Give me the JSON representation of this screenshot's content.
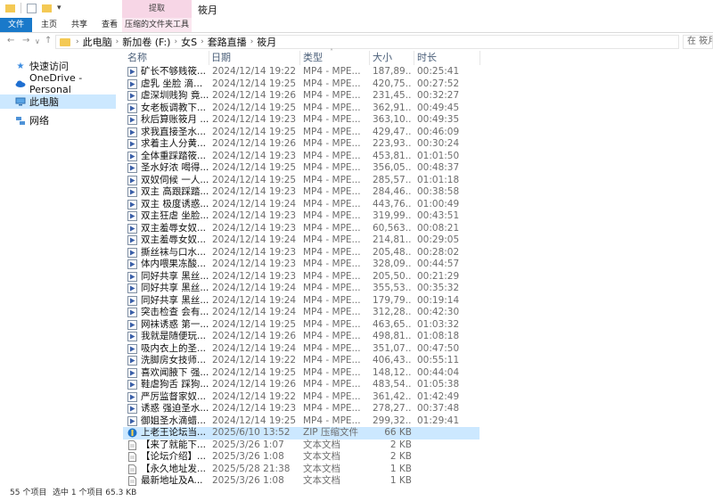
{
  "window": {
    "title": "筱月",
    "context_group": "提取"
  },
  "ribbon": {
    "tabs": [
      "文件",
      "主页",
      "共享",
      "查看",
      "压缩的文件夹工具"
    ]
  },
  "address": {
    "crumbs": [
      "此电脑",
      "新加卷 (F:)",
      "女S",
      "套路直播",
      "筱月"
    ],
    "search_placeholder": "在 筱月"
  },
  "nav": {
    "items": [
      {
        "label": "快速访问",
        "icon": "star-icon"
      },
      {
        "label": "OneDrive - Personal",
        "icon": "cloud-icon"
      },
      {
        "label": "此电脑",
        "icon": "pc-icon"
      },
      {
        "label": "网络",
        "icon": "network-icon"
      }
    ]
  },
  "columns": {
    "name": "名称",
    "date": "日期",
    "type": "类型",
    "size": "大小",
    "length": "时长"
  },
  "files": [
    {
      "name": "矿长不够贱筱...",
      "date": "2024/12/14 19:22",
      "type": "MP4 - MPE...",
      "size": "187,89...",
      "length": "00:25:41",
      "kind": "video"
    },
    {
      "name": "虐乳 坐脸 滴...",
      "date": "2024/12/14 19:25",
      "type": "MP4 - MPE...",
      "size": "420,75...",
      "length": "00:27:52",
      "kind": "video"
    },
    {
      "name": "虐深圳贱狗 竟...",
      "date": "2024/12/14 19:26",
      "type": "MP4 - MPE...",
      "size": "231,45...",
      "length": "00:32:27",
      "kind": "video"
    },
    {
      "name": "女老板调教下...",
      "date": "2024/12/14 19:25",
      "type": "MP4 - MPE...",
      "size": "362,91...",
      "length": "00:49:45",
      "kind": "video"
    },
    {
      "name": "秋后算账筱月 ...",
      "date": "2024/12/14 19:23",
      "type": "MP4 - MPE...",
      "size": "363,10...",
      "length": "00:49:35",
      "kind": "video"
    },
    {
      "name": "求我直接圣水...",
      "date": "2024/12/14 19:25",
      "type": "MP4 - MPE...",
      "size": "429,47...",
      "length": "00:46:09",
      "kind": "video"
    },
    {
      "name": "求着主人分黄...",
      "date": "2024/12/14 19:26",
      "type": "MP4 - MPE...",
      "size": "223,93...",
      "length": "00:30:24",
      "kind": "video"
    },
    {
      "name": "全体重踩踏筱...",
      "date": "2024/12/14 19:23",
      "type": "MP4 - MPE...",
      "size": "453,81...",
      "length": "01:01:50",
      "kind": "video"
    },
    {
      "name": "圣水好浓 喝得...",
      "date": "2024/12/14 19:25",
      "type": "MP4 - MPE...",
      "size": "356,05...",
      "length": "00:48:37",
      "kind": "video"
    },
    {
      "name": "双奴伺候 一人...",
      "date": "2024/12/14 19:25",
      "type": "MP4 - MPE...",
      "size": "285,57...",
      "length": "01:01:18",
      "kind": "video"
    },
    {
      "name": "双主 高跟踩踏...",
      "date": "2024/12/14 19:23",
      "type": "MP4 - MPE...",
      "size": "284,46...",
      "length": "00:38:58",
      "kind": "video"
    },
    {
      "name": "双主 极度诱惑...",
      "date": "2024/12/14 19:24",
      "type": "MP4 - MPE...",
      "size": "443,76...",
      "length": "01:00:49",
      "kind": "video"
    },
    {
      "name": "双主狂虐 坐脸...",
      "date": "2024/12/14 19:23",
      "type": "MP4 - MPE...",
      "size": "319,99...",
      "length": "00:43:51",
      "kind": "video"
    },
    {
      "name": "双主羞辱女奴...",
      "date": "2024/12/14 19:23",
      "type": "MP4 - MPE...",
      "size": "60,563...",
      "length": "00:08:21",
      "kind": "video"
    },
    {
      "name": "双主羞辱女奴...",
      "date": "2024/12/14 19:24",
      "type": "MP4 - MPE...",
      "size": "214,81...",
      "length": "00:29:05",
      "kind": "video"
    },
    {
      "name": "撕丝袜与口水...",
      "date": "2024/12/14 19:23",
      "type": "MP4 - MPE...",
      "size": "205,48...",
      "length": "00:28:02",
      "kind": "video"
    },
    {
      "name": "体内喂果冻酸...",
      "date": "2024/12/14 19:23",
      "type": "MP4 - MPE...",
      "size": "328,09...",
      "length": "00:44:57",
      "kind": "video"
    },
    {
      "name": "同好共享 黑丝...",
      "date": "2024/12/14 19:23",
      "type": "MP4 - MPE...",
      "size": "205,50...",
      "length": "00:21:29",
      "kind": "video"
    },
    {
      "name": "同好共享 黑丝...",
      "date": "2024/12/14 19:24",
      "type": "MP4 - MPE...",
      "size": "355,53...",
      "length": "00:35:32",
      "kind": "video"
    },
    {
      "name": "同好共享 黑丝...",
      "date": "2024/12/14 19:24",
      "type": "MP4 - MPE...",
      "size": "179,79...",
      "length": "00:19:14",
      "kind": "video"
    },
    {
      "name": "突击检查 会有...",
      "date": "2024/12/14 19:24",
      "type": "MP4 - MPE...",
      "size": "312,28...",
      "length": "00:42:30",
      "kind": "video"
    },
    {
      "name": "网袜诱惑 第一...",
      "date": "2024/12/14 19:25",
      "type": "MP4 - MPE...",
      "size": "463,65...",
      "length": "01:03:32",
      "kind": "video"
    },
    {
      "name": "我就是随便玩...",
      "date": "2024/12/14 19:26",
      "type": "MP4 - MPE...",
      "size": "498,81...",
      "length": "01:08:18",
      "kind": "video"
    },
    {
      "name": "吸内衣上的圣...",
      "date": "2024/12/14 19:24",
      "type": "MP4 - MPE...",
      "size": "351,07...",
      "length": "00:47:50",
      "kind": "video"
    },
    {
      "name": "洗脚房女技师...",
      "date": "2024/12/14 19:22",
      "type": "MP4 - MPE...",
      "size": "406,43...",
      "length": "00:55:11",
      "kind": "video"
    },
    {
      "name": "喜欢闻腋下 强...",
      "date": "2024/12/14 19:25",
      "type": "MP4 - MPE...",
      "size": "148,12...",
      "length": "00:44:04",
      "kind": "video"
    },
    {
      "name": "鞋虐狗舌 踩狗...",
      "date": "2024/12/14 19:26",
      "type": "MP4 - MPE...",
      "size": "483,54...",
      "length": "01:05:38",
      "kind": "video"
    },
    {
      "name": "严厉监督家奴...",
      "date": "2024/12/14 19:22",
      "type": "MP4 - MPE...",
      "size": "361,42...",
      "length": "01:42:49",
      "kind": "video"
    },
    {
      "name": "诱惑 强迫圣水...",
      "date": "2024/12/14 19:23",
      "type": "MP4 - MPE...",
      "size": "278,27...",
      "length": "00:37:48",
      "kind": "video"
    },
    {
      "name": "御姐圣水滴蜡...",
      "date": "2024/12/14 19:25",
      "type": "MP4 - MPE...",
      "size": "299,32...",
      "length": "01:29:41",
      "kind": "video"
    },
    {
      "name": "上老王论坛当...",
      "date": "2025/6/10 13:52",
      "type": "ZIP 压缩文件",
      "size": "66 KB",
      "length": "",
      "kind": "zip",
      "selected": true
    },
    {
      "name": "【来了就能下...",
      "date": "2025/3/26 1:07",
      "type": "文本文档",
      "size": "2 KB",
      "length": "",
      "kind": "text"
    },
    {
      "name": "【论坛介绍】...",
      "date": "2025/3/26 1:08",
      "type": "文本文档",
      "size": "2 KB",
      "length": "",
      "kind": "text"
    },
    {
      "name": "【永久地址发...",
      "date": "2025/5/28 21:38",
      "type": "文本文档",
      "size": "1 KB",
      "length": "",
      "kind": "text"
    },
    {
      "name": "最新地址及A...",
      "date": "2025/3/26 1:08",
      "type": "文本文档",
      "size": "1 KB",
      "length": "",
      "kind": "text"
    }
  ],
  "status": {
    "count": "55 个项目",
    "selected": "选中 1 个项目  65.3 KB"
  },
  "colors": {
    "file_tab": "#1979ca",
    "context_tab": "#f7d6e6",
    "selection": "#cce8ff"
  }
}
